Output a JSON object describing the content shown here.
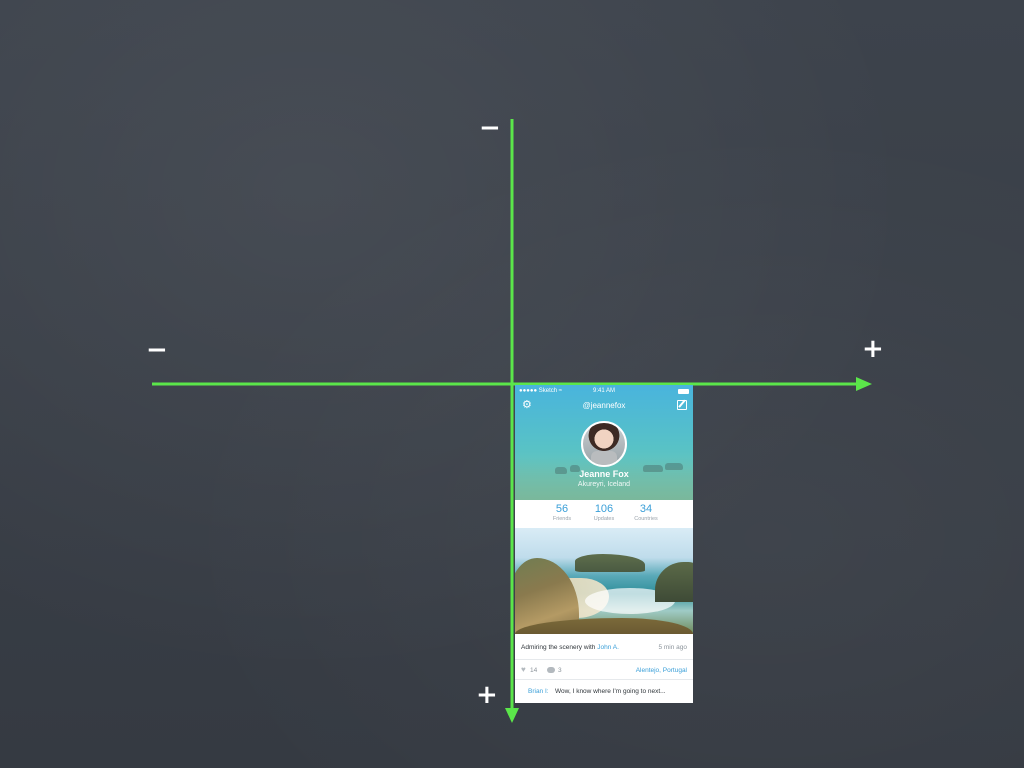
{
  "axes": {
    "top_mark": "−",
    "left_mark": "−",
    "right_mark": "+",
    "bottom_mark": "+",
    "color": "#5be64a"
  },
  "phone": {
    "status_bar": {
      "carrier": "●●●●● Sketch ≈",
      "time": "9:41 AM"
    },
    "nav": {
      "handle": "@jeannefox",
      "settings_icon": "gear-icon",
      "compose_icon": "compose-icon"
    },
    "profile": {
      "name": "Jeanne Fox",
      "location": "Akureyri, Iceland"
    },
    "stats": [
      {
        "value": "56",
        "label": "Friends"
      },
      {
        "value": "106",
        "label": "Updates"
      },
      {
        "value": "34",
        "label": "Countries"
      }
    ],
    "post": {
      "caption_prefix": "Admiring the scenery with ",
      "caption_mention": "John A.",
      "time": "5 min ago",
      "likes": "14",
      "comments": "3",
      "place": "Alentejo, Portugal"
    },
    "comment": {
      "author": "Brian I:",
      "text": "Wow, I know where I'm going to next..."
    },
    "accent_color": "#3a9fd8"
  }
}
